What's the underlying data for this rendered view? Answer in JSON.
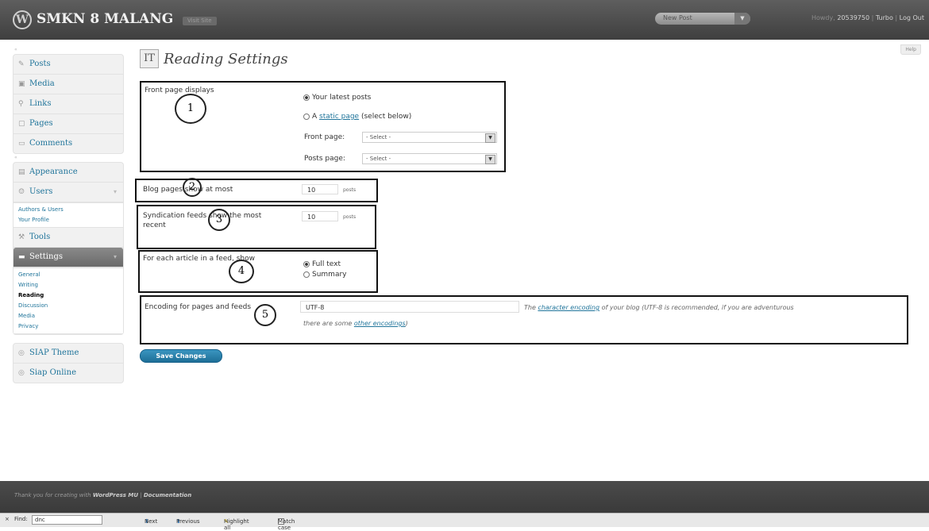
{
  "header": {
    "logo": "W",
    "site_title": "SMKN 8 MALANG",
    "visit_site": "Visit Site",
    "new_post": "New Post",
    "howdy": "Howdy,",
    "username": "20539750",
    "turbo": "Turbo",
    "logout": "Log Out",
    "separator": "|"
  },
  "sidebar": {
    "sep_label": "«",
    "group1": [
      {
        "label": "Posts",
        "icon": "pin-icon"
      },
      {
        "label": "Media",
        "icon": "media-icon"
      },
      {
        "label": "Links",
        "icon": "link-icon"
      },
      {
        "label": "Pages",
        "icon": "page-icon"
      },
      {
        "label": "Comments",
        "icon": "comment-icon"
      }
    ],
    "group2": {
      "appearance": "Appearance",
      "users": "Users",
      "users_sub": [
        "Authors & Users",
        "Your Profile"
      ],
      "tools": "Tools",
      "settings": "Settings",
      "settings_sub": [
        "General",
        "Writing",
        "Reading",
        "Discussion",
        "Media",
        "Privacy"
      ],
      "current": "Reading"
    },
    "group3": [
      "SIAP Theme",
      "Siap Online"
    ]
  },
  "help": "Help",
  "page": {
    "icon": "IT",
    "title": "Reading Settings"
  },
  "front_page": {
    "label": "Front page displays",
    "latest_posts": "Your latest posts",
    "static_prefix": "A",
    "static_link": "static page",
    "static_suffix": "(select below)",
    "front_page_label": "Front page:",
    "posts_page_label": "Posts page:",
    "select_value": "- Select -"
  },
  "blog_pages": {
    "label": "Blog pages show at most",
    "value": "10",
    "unit": "posts"
  },
  "syndication": {
    "label": "Syndication feeds show the most recent",
    "value": "10",
    "unit": "posts"
  },
  "article_feed": {
    "label": "For each article in a feed, show",
    "full_text": "Full text",
    "summary": "Summary"
  },
  "encoding": {
    "label": "Encoding for pages and feeds",
    "value": "UTF-8",
    "desc_pre": "The",
    "desc_link": "character encoding",
    "desc_post": "of your blog (UTF-8 is recommended, if you are adventurous",
    "desc2_pre": "there are some",
    "desc2_link": "other encodings",
    "desc2_post": ")"
  },
  "annotations": [
    "1",
    "2",
    "3",
    "4",
    "5"
  ],
  "save_button": "Save Changes",
  "footer": {
    "thanks": "Thank you for creating with",
    "wpmu": "WordPress MU",
    "sep": "|",
    "docs": "Documentation"
  },
  "findbar": {
    "close": "×",
    "find_label": "Find:",
    "find_value": "dnc",
    "next": "Next",
    "previous": "Previous",
    "highlight": "Highlight all",
    "match_case": "Match case"
  }
}
